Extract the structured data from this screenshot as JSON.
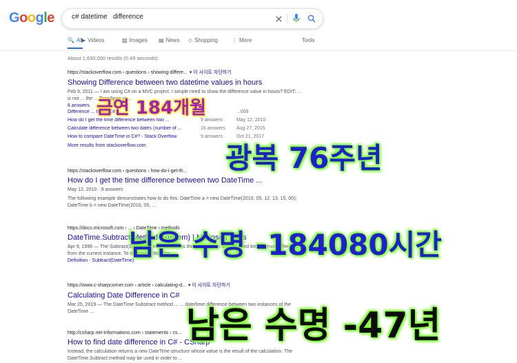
{
  "logo": [
    "G",
    "o",
    "o",
    "g",
    "l",
    "e"
  ],
  "search": {
    "query": "c# datetime   difference"
  },
  "tabs": [
    {
      "label": "All",
      "icon": "search-icon"
    },
    {
      "label": "Videos",
      "icon": "video-icon"
    },
    {
      "label": "Images",
      "icon": "image-icon"
    },
    {
      "label": "News",
      "icon": "news-icon"
    },
    {
      "label": "Shopping",
      "icon": "tag-icon"
    },
    {
      "label": "More",
      "icon": "more-icon"
    }
  ],
  "tools_label": "Tools",
  "stats": "About 1,630,000 results (0.49 seconds)",
  "block_label": "▾ 이 사이트 차단하기",
  "results": [
    {
      "url": "https://stackoverflow.com › questions › showing-differe...",
      "title": "Showing Difference between two datetime values in hours",
      "snippet": "Feb 9, 2011 — I am using C# on a MVC project. I simple need to show the difference value in hours? EDIT: ... is not ... the ... TimeSpan yo...",
      "answers": "8 answers",
      "sitelinks": [
        {
          "text": "Difference ... times C# ...",
          "n": "",
          "d": "...009"
        },
        {
          "text": "How do I get the time difference between two ...",
          "n": "9 answers",
          "d": "May 12, 2010"
        },
        {
          "text": "Calculate difference between two dates (number of ...",
          "n": "16 answers",
          "d": "Aug 27, 2015"
        },
        {
          "text": "How to compare DateTime in C#? - Stack Overflow",
          "n": "9 answers",
          "d": "Oct 21, 2017"
        }
      ],
      "more": "More results from stackoverflow.com"
    },
    {
      "url": "https://stackoverflow.com › questions › how-do-i-get-th...",
      "title": "How do I get the time difference between two DateTime ...",
      "meta": "May 12, 2010 · 9 answers",
      "snippet": "The following example demonstrates how to do this: DateTime a = new DateTime(2010, 05, 12, 13, 15, 00); DateTime b = new DateTime(2010, 05, ..."
    },
    {
      "url": "https://docs.microsoft.com › ... › DateTime › methods",
      "title": "DateTime.Subtract Method (System) | Microsoft Docs",
      "snippet": "Apr 9, 1996 — The Subtract(DateTime) method returns the value that is the specified time interval difference from the current instance. To determine the time ...",
      "links": "Definition · Subtract(DateTime)"
    },
    {
      "url": "https://www.c-sharpcorner.com › article › calculating-d...",
      "title": "Calculating Date Difference in C#",
      "snippet": "Mar 25, 2019 — The DateTime Substract method ... ... date/time difference between two instances of the DateTime ..."
    },
    {
      "url": "http://csharp.net-informations.com › statements › cs...",
      "title": "How to find date difference in C# - CSharp",
      "snippet": "Instead, the calculation returns a new DateTime structure whose value is the result of the calculation. The DateTime.Subtract method may be used in order to ..."
    }
  ],
  "overlays": {
    "line1": "금연 184개월",
    "line2": "광복 76주년",
    "line3": "남은 수명 -184080시간",
    "line4": "남은 수명 -47년"
  },
  "colors": {
    "link": "#1a0dab",
    "accent": "#1a73e8"
  }
}
